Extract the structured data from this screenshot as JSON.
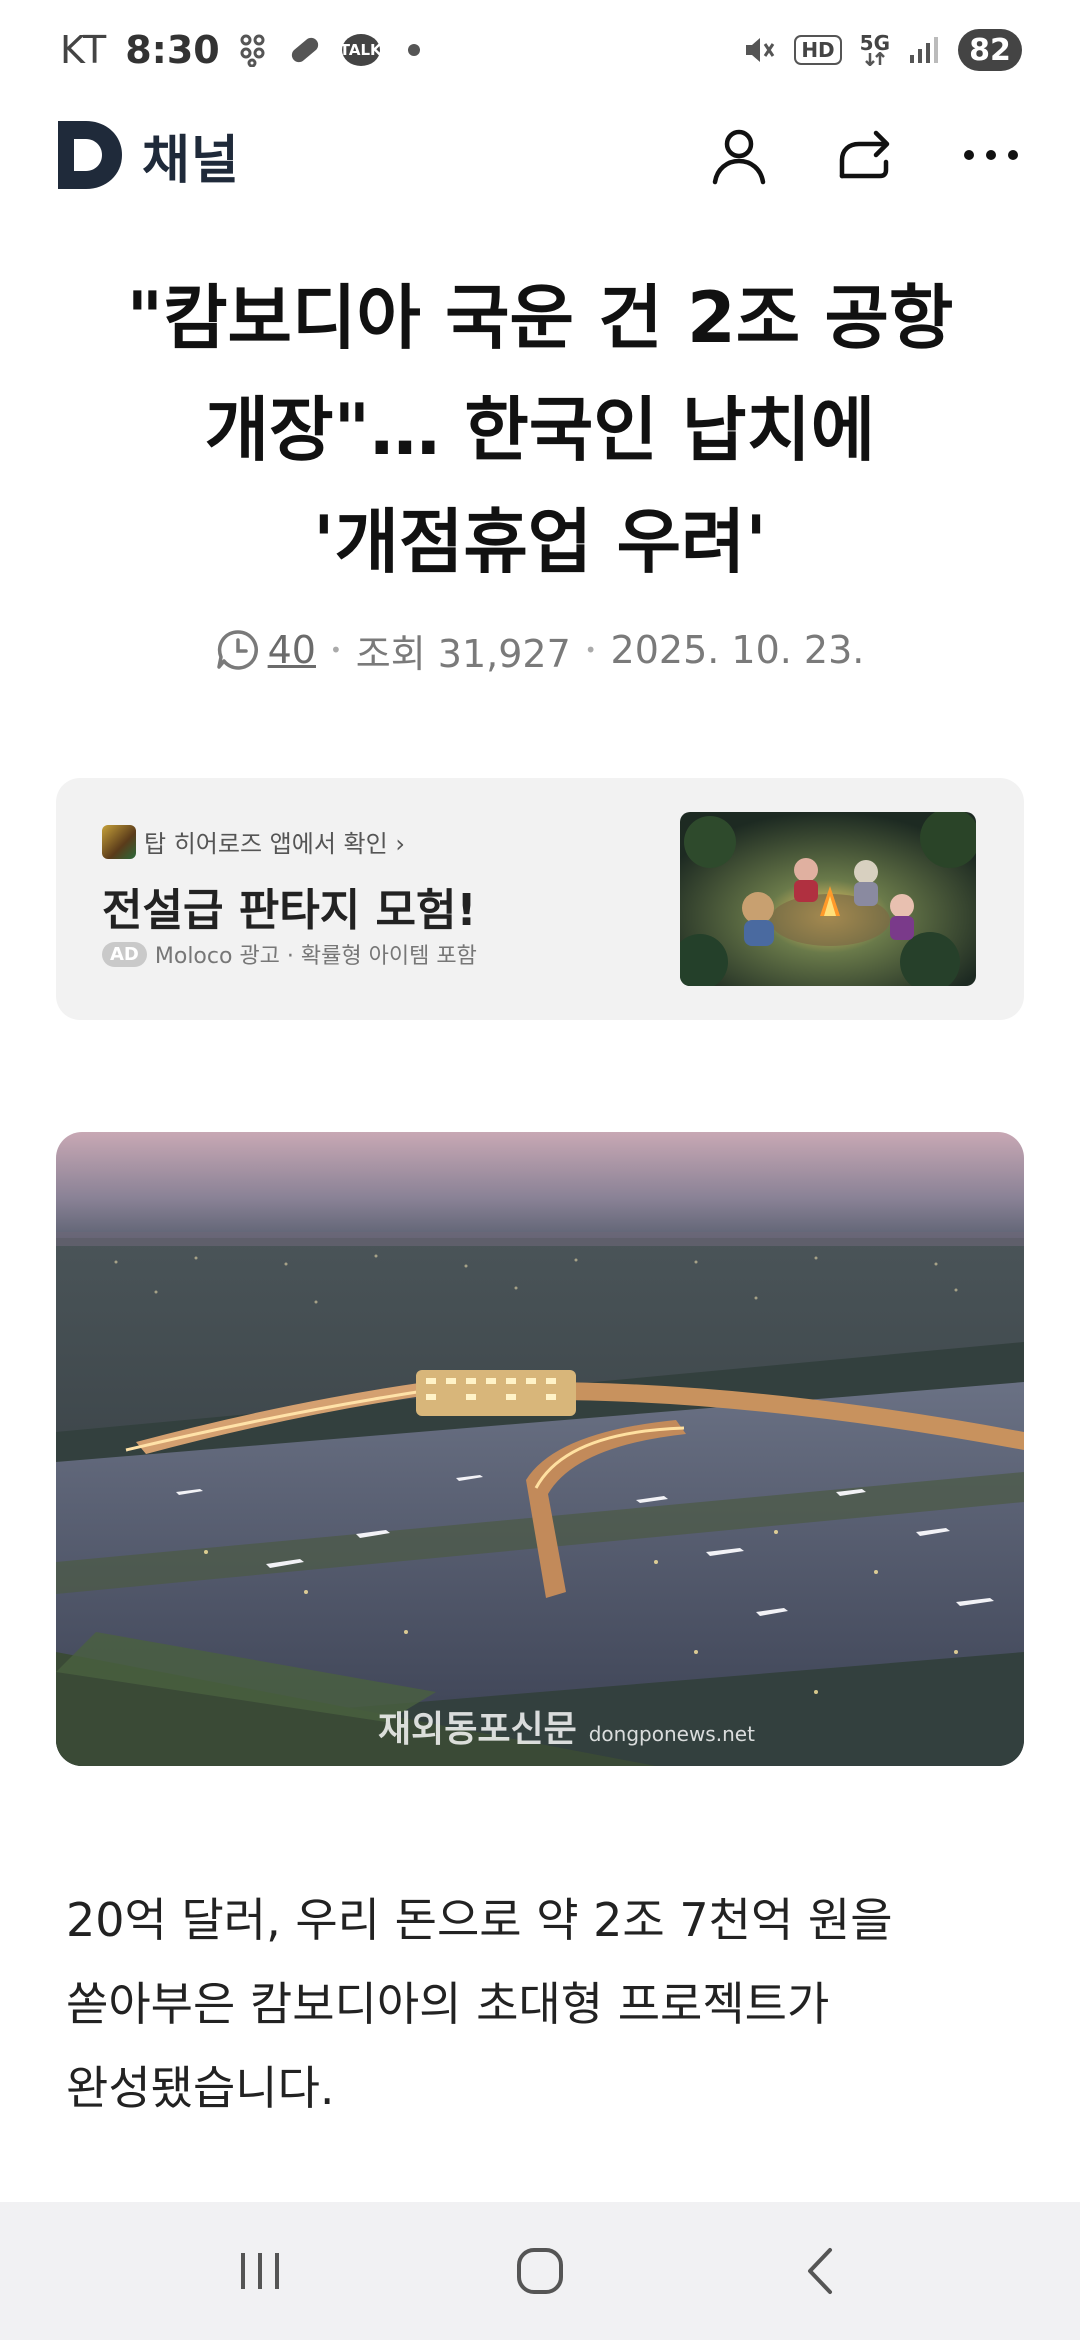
{
  "status_bar": {
    "carrier": "KT",
    "time": "8:30",
    "talk_label": "TALK",
    "hd_label": "HD",
    "network": "5G",
    "battery": "82"
  },
  "header": {
    "logo_letter": "D",
    "brand_name": "채널"
  },
  "article": {
    "headline_line1": "\"캄보디아 국운 건 2조 공항",
    "headline_line2": "개장\"… 한국인 납치에",
    "headline_line3": "'개점휴업 우려'",
    "comment_count": "40",
    "views": "조회 31,927",
    "date": "2025. 10. 23.",
    "body_line1": "20억 달러, 우리 돈으로 약 2조 7천억 원을",
    "body_line2": "쏟아부은 캄보디아의 초대형 프로젝트가",
    "body_line3": "완성됐습니다.",
    "image_watermark": "재외동포신문",
    "image_watermark_url": "dongponews.net"
  },
  "ad": {
    "source_label": "탑 히어로즈 앱에서 확인 ›",
    "title": "전설급 판타지 모험!",
    "tag": "AD",
    "advertiser": "Moloco 광고 · 확률형 아이템 포함"
  },
  "colors": {
    "brand": "#1f2a3a",
    "nav_bg": "#f1f1f3",
    "ad_bg": "#f2f2f2"
  }
}
